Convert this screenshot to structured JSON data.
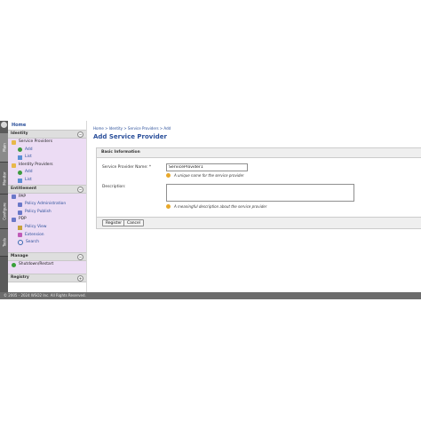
{
  "side_tabs": [
    "Main",
    "Monitor",
    "Configure",
    "Tools"
  ],
  "nav": {
    "home": "Home",
    "sections": [
      {
        "title": "Identity",
        "items": [
          {
            "label": "Service Providers",
            "level": 1,
            "icon": "folder-icon"
          },
          {
            "label": "Add",
            "level": 2,
            "icon": "add-icon"
          },
          {
            "label": "List",
            "level": 2,
            "icon": "list-icon"
          },
          {
            "label": "Identity Providers",
            "level": 1,
            "icon": "folder-icon"
          },
          {
            "label": "Add",
            "level": 2,
            "icon": "add-icon"
          },
          {
            "label": "List",
            "level": 2,
            "icon": "list-icon"
          }
        ]
      },
      {
        "title": "Entitlement",
        "items": [
          {
            "label": "PAP",
            "level": 1,
            "icon": "policy-icon"
          },
          {
            "label": "Policy Administration",
            "level": 2,
            "icon": "policy-icon"
          },
          {
            "label": "Policy Publish",
            "level": 2,
            "icon": "policy-icon"
          },
          {
            "label": "PDP",
            "level": 1,
            "icon": "policy-icon"
          },
          {
            "label": "Policy View",
            "level": 2,
            "icon": "view-icon"
          },
          {
            "label": "Extension",
            "level": 2,
            "icon": "extension-icon"
          },
          {
            "label": "Search",
            "level": 2,
            "icon": "search-icon"
          }
        ]
      },
      {
        "title": "Manage",
        "items": [
          {
            "label": "Shutdown/Restart",
            "level": 1,
            "icon": "power-icon"
          }
        ]
      },
      {
        "title": "Registry",
        "items": []
      }
    ]
  },
  "main": {
    "breadcrumb": "Home > Identity > Service Providers > Add",
    "title": "Add Service Provider",
    "form_header": "Basic Information",
    "fields": {
      "name_label": "Service Provider Name: *",
      "name_value": "ServiceProvider1",
      "name_hint": "A unique name for the service provider",
      "desc_label": "Description:",
      "desc_value": "",
      "desc_hint": "A meaningful description about the service provider"
    },
    "buttons": {
      "register": "Register",
      "cancel": "Cancel"
    }
  },
  "footer": "© 2005 - 2024 WSO2 Inc. All Rights Reserved.",
  "colors": {
    "accent": "#2a4f9a",
    "nav_bg": "#ecdcf4",
    "footer_bg": "#6c6c6c"
  }
}
